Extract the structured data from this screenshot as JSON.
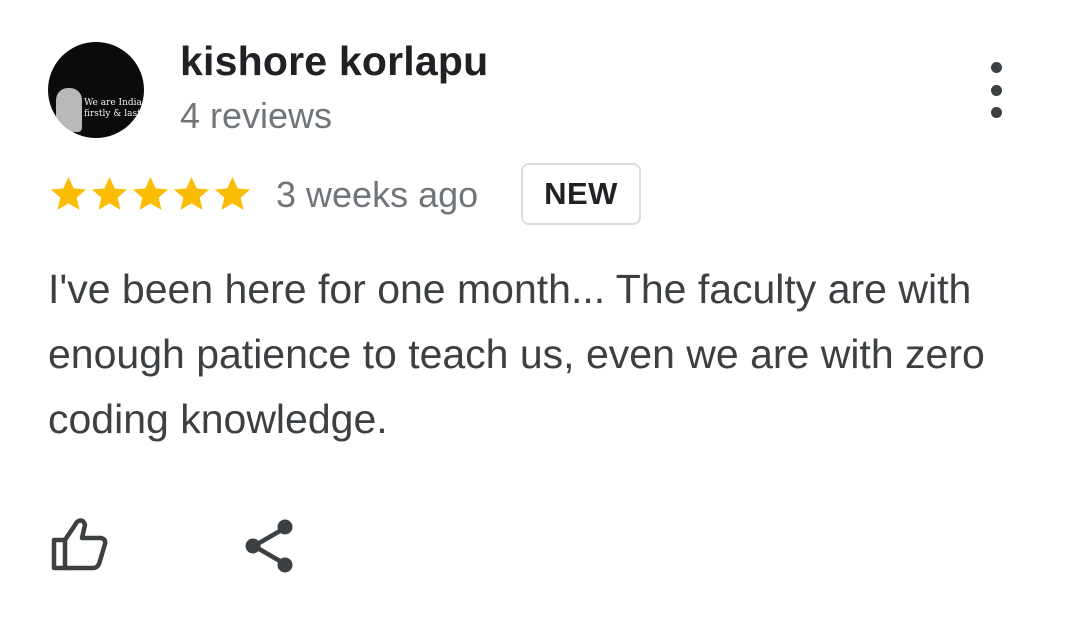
{
  "review": {
    "reviewer_name": "kishore korlapu",
    "review_count": "4 reviews",
    "avatar_caption_line1": "We are Indians,",
    "avatar_caption_line2": "firstly & lastly",
    "rating": 5,
    "rating_max": 5,
    "star_color": "#fbbc04",
    "time_ago": "3 weeks ago",
    "badge": "NEW",
    "text": "I've been here for one month... The faculty are with enough patience to teach us, even we are with zero coding knowledge."
  },
  "icons": {
    "more": "more-vert-icon",
    "like": "thumb-up-icon",
    "share": "share-icon",
    "star": "star-icon"
  }
}
